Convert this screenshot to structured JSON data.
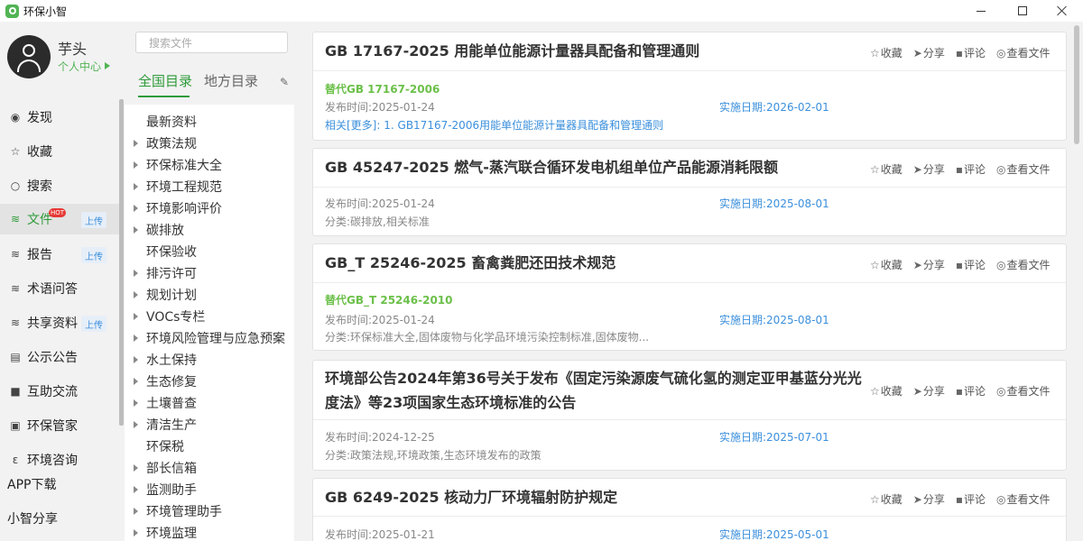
{
  "window": {
    "title": "环保小智"
  },
  "profile": {
    "name": "芋头",
    "link": "个人中心"
  },
  "nav": {
    "items": [
      {
        "label": "发现",
        "icon": "eye-icon"
      },
      {
        "label": "收藏",
        "icon": "star-icon"
      },
      {
        "label": "搜索",
        "icon": "search-icon"
      },
      {
        "label": "文件",
        "icon": "layers-icon",
        "badge": "上传",
        "hot": "HOT"
      },
      {
        "label": "报告",
        "icon": "layers-icon",
        "badge": "上传"
      },
      {
        "label": "术语问答",
        "icon": "layers-icon"
      },
      {
        "label": "共享资料",
        "icon": "layers-icon",
        "badge": "上传"
      },
      {
        "label": "公示公告",
        "icon": "notice-icon"
      },
      {
        "label": "互助交流",
        "icon": "chat-icon"
      },
      {
        "label": "环保管家",
        "icon": "manager-icon"
      },
      {
        "label": "环境咨询",
        "icon": "consult-icon"
      }
    ],
    "app_download": "APP下载",
    "share": "小智分享"
  },
  "catalog": {
    "search_placeholder": "搜索文件",
    "tab_national": "全国目录",
    "tab_local": "地方目录",
    "items": [
      {
        "label": "最新资料",
        "expandable": false
      },
      {
        "label": "政策法规",
        "expandable": true
      },
      {
        "label": "环保标准大全",
        "expandable": true
      },
      {
        "label": "环境工程规范",
        "expandable": true
      },
      {
        "label": "环境影响评价",
        "expandable": true
      },
      {
        "label": "碳排放",
        "expandable": true
      },
      {
        "label": "环保验收",
        "expandable": false
      },
      {
        "label": "排污许可",
        "expandable": true
      },
      {
        "label": "规划计划",
        "expandable": true
      },
      {
        "label": "VOCs专栏",
        "expandable": true
      },
      {
        "label": "环境风险管理与应急预案",
        "expandable": true
      },
      {
        "label": "水土保持",
        "expandable": true
      },
      {
        "label": "生态修复",
        "expandable": true
      },
      {
        "label": "土壤普查",
        "expandable": true
      },
      {
        "label": "清洁生产",
        "expandable": true
      },
      {
        "label": "环保税",
        "expandable": false
      },
      {
        "label": "部长信箱",
        "expandable": true
      },
      {
        "label": "监测助手",
        "expandable": true
      },
      {
        "label": "环境管理助手",
        "expandable": true
      },
      {
        "label": "环境监理",
        "expandable": true
      }
    ]
  },
  "actions": {
    "favorite": "收藏",
    "share": "分享",
    "comment": "评论",
    "view": "查看文件"
  },
  "docs": [
    {
      "title": "GB 17167-2025 用能单位能源计量器具配备和管理通则",
      "replace": "替代GB 17167-2006",
      "publish_label": "发布时间:",
      "publish_date": "2025-01-24",
      "impl_label": "实施日期:",
      "impl_date": "2026-02-01",
      "related_label": "相关[更多]:",
      "related_text": "1. GB17167-2006用能单位能源计量器具配备和管理通则"
    },
    {
      "title": "GB 45247-2025 燃气-蒸汽联合循环发电机组单位产品能源消耗限额",
      "publish_label": "发布时间:",
      "publish_date": "2025-01-24",
      "impl_label": "实施日期:",
      "impl_date": "2025-08-01",
      "category_label": "分类:",
      "category": "碳排放,相关标准"
    },
    {
      "title": "GB_T 25246-2025 畜禽粪肥还田技术规范",
      "replace": "替代GB_T 25246-2010",
      "publish_label": "发布时间:",
      "publish_date": "2025-01-24",
      "impl_label": "实施日期:",
      "impl_date": "2025-08-01",
      "category_label": "分类:",
      "category": "环保标准大全,固体废物与化学品环境污染控制标准,固体废物..."
    },
    {
      "title_line1": "环境部公告2024年第36号关于发布《固定污染源废气硫化氢的测定亚甲基蓝分光光",
      "title_line2": "度法》等23项国家生态环境标准的公告",
      "publish_label": "发布时间:",
      "publish_date": "2024-12-25",
      "impl_label": "实施日期:",
      "impl_date": "2025-07-01",
      "category_label": "分类:",
      "category": "政策法规,环境政策,生态环境发布的政策"
    },
    {
      "title": "GB 6249-2025 核动力厂环境辐射防护规定",
      "publish_label": "发布时间:",
      "publish_date": "2025-01-21",
      "impl_label": "实施日期:",
      "impl_date": "2025-05-01"
    }
  ]
}
